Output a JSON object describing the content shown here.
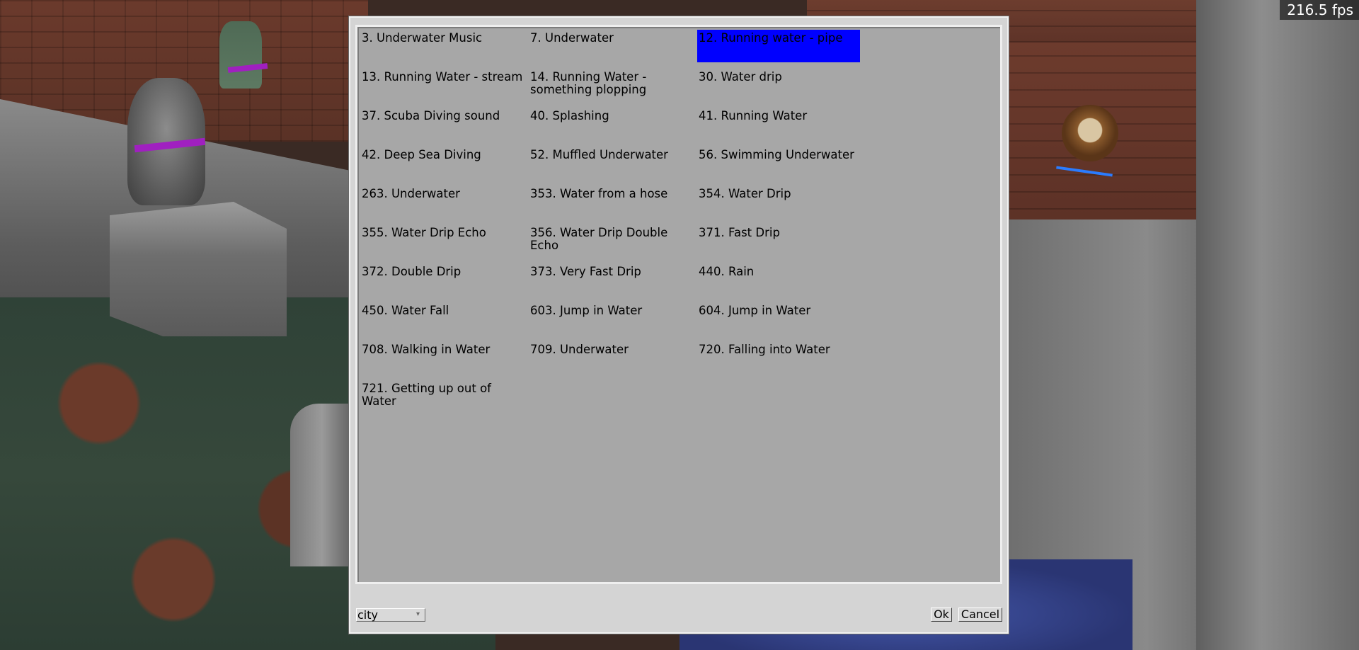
{
  "fps_counter": "216.5 fps",
  "sound_list": {
    "selected_index": 2,
    "items": [
      "3. Underwater Music",
      "7. Underwater",
      "12. Running water - pipe",
      "13. Running Water - stream",
      "14. Running Water - something plopping",
      "30. Water drip",
      "37. Scuba Diving sound",
      "40. Splashing",
      "41. Running Water",
      "42. Deep Sea Diving",
      "52. Muffled Underwater",
      "56. Swimming Underwater",
      "263. Underwater",
      "353. Water from a hose",
      "354. Water Drip",
      "355. Water Drip Echo",
      "356. Water Drip Double Echo",
      "371. Fast Drip",
      "372. Double Drip",
      "373. Very Fast Drip",
      "440. Rain",
      "450. Water Fall",
      "603. Jump in Water",
      "604. Jump in Water",
      "708. Walking in Water",
      "709. Underwater",
      "720. Falling into Water",
      "721. Getting up out of Water"
    ]
  },
  "filter": {
    "selected_value": "city",
    "arrow_icon": "chevron-down-icon"
  },
  "buttons": {
    "ok_label": "Ok",
    "cancel_label": "Cancel"
  },
  "colors": {
    "selection": "#0000ff",
    "list_background": "#a7a7a7",
    "dialog_background": "#d4d4d4"
  }
}
